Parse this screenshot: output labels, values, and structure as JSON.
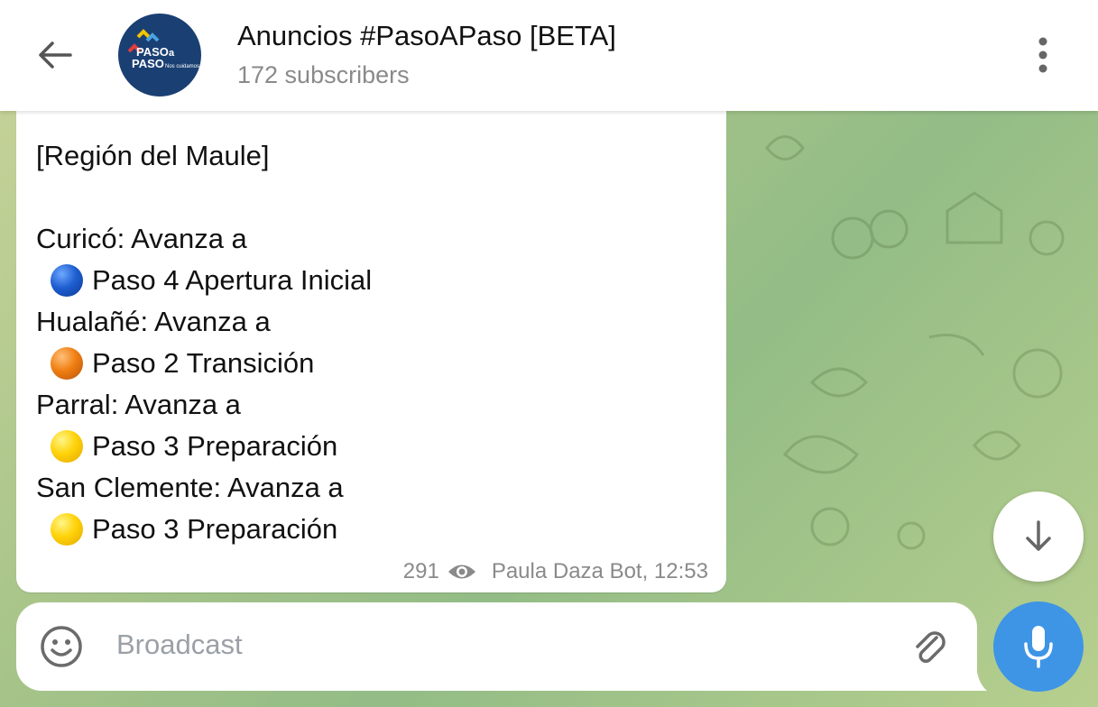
{
  "header": {
    "back_icon": "arrow-left-icon",
    "title": "Anuncios #PasoAPaso [BETA]",
    "subtitle": "172 subscribers",
    "avatar": {
      "logo_text_1": "PASO",
      "logo_text_2": "a",
      "logo_text_3": "PASO",
      "logo_tagline": "Nos cuidamos"
    },
    "menu_icon": "more-vertical-icon"
  },
  "message": {
    "region": "[Región del Maule]",
    "entries": [
      {
        "commune": "Curicó",
        "action": ": Avanza a",
        "phase": "Paso 4 Apertura Inicial",
        "dot_color": "blue"
      },
      {
        "commune": "Hualañé",
        "action": ": Avanza a",
        "phase": "Paso 2 Transición",
        "dot_color": "orange"
      },
      {
        "commune": "Parral",
        "action": ": Avanza a",
        "phase": "Paso 3 Preparación",
        "dot_color": "yellow"
      },
      {
        "commune": "San Clemente",
        "action": ": Avanza a",
        "phase": "Paso 3 Preparación",
        "dot_color": "yellow"
      }
    ],
    "views": "291",
    "signature": "Paula Daza Bot, 12:53"
  },
  "input": {
    "placeholder": "Broadcast",
    "emoji_icon": "smiley-icon",
    "attach_icon": "paperclip-icon"
  },
  "buttons": {
    "scroll_down_icon": "arrow-down-icon",
    "mic_icon": "microphone-icon"
  },
  "colors": {
    "accent": "#3e95e6",
    "avatar_bg": "#1a3f73",
    "wallpaper": "#a9c58a"
  }
}
